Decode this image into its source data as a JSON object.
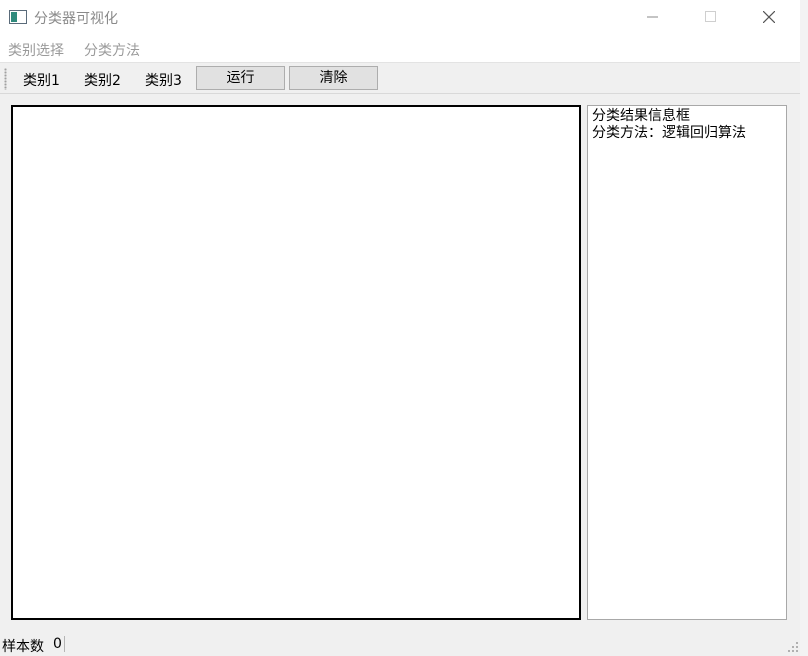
{
  "window": {
    "title": "分类器可视化",
    "icons": {
      "app": "app-window-icon",
      "minimize": "minimize-icon",
      "maximize": "maximize-icon",
      "close": "close-icon"
    }
  },
  "menu": {
    "items": [
      "类别选择",
      "分类方法"
    ]
  },
  "toolbar": {
    "class_options": [
      "类别1",
      "类别2",
      "类别3"
    ],
    "run_label": "运行",
    "clear_label": "清除"
  },
  "info_panel": {
    "lines": [
      "分类结果信息框",
      "分类方法：逻辑回归算法"
    ]
  },
  "status": {
    "label": "样本数",
    "value": "0"
  }
}
